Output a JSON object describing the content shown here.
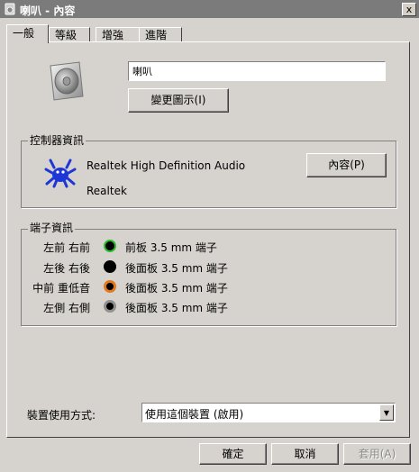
{
  "window": {
    "title": "喇叭 - 內容",
    "close_glyph": "x"
  },
  "tabs": [
    {
      "label": "一般"
    },
    {
      "label": "等級"
    },
    {
      "label": "增強"
    },
    {
      "label": "進階"
    }
  ],
  "general": {
    "device_name": "喇叭",
    "change_icon_label": "變更圖示(I)"
  },
  "controller": {
    "legend": "控制器資訊",
    "name": "Realtek High Definition Audio",
    "vendor": "Realtek",
    "properties_label": "內容(P)"
  },
  "jacks": {
    "legend": "端子資訊",
    "items": [
      {
        "channel": "左前 右前",
        "desc": "前板 3.5 mm 端子",
        "color": "#2dbe2d",
        "icon": "green-jack-icon"
      },
      {
        "channel": "左後 右後",
        "desc": "後面板 3.5 mm 端子",
        "color": "#000000",
        "icon": "black-jack-icon"
      },
      {
        "channel": "中前 重低音",
        "desc": "後面板 3.5 mm 端子",
        "color": "#e07a1c",
        "icon": "orange-jack-icon"
      },
      {
        "channel": "左側 右側",
        "desc": "後面板 3.5 mm 端子",
        "color": "#909090",
        "icon": "gray-jack-icon"
      }
    ]
  },
  "usage": {
    "label": "裝置使用方式:",
    "selected": "使用這個裝置 (啟用)"
  },
  "buttons": {
    "ok": "確定",
    "cancel": "取消",
    "apply": "套用(A)"
  }
}
